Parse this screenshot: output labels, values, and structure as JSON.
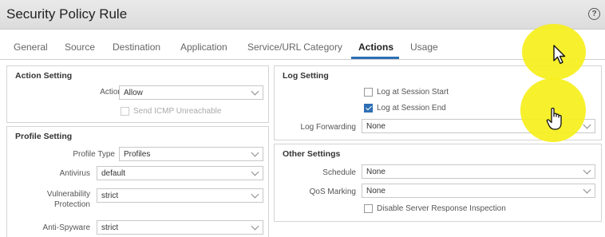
{
  "window": {
    "title": "Security Policy Rule",
    "help_icon": "?"
  },
  "tabs": [
    {
      "label": "General"
    },
    {
      "label": "Source"
    },
    {
      "label": "Destination"
    },
    {
      "label": "Application"
    },
    {
      "label": "Service/URL Category"
    },
    {
      "label": "Actions",
      "active": true
    },
    {
      "label": "Usage"
    }
  ],
  "action_setting": {
    "title": "Action Setting",
    "action_label": "Action",
    "action_value": "Allow",
    "send_icmp_label": "Send ICMP Unreachable",
    "send_icmp_checked": false
  },
  "profile_setting": {
    "title": "Profile Setting",
    "profile_type_label": "Profile Type",
    "profile_type_value": "Profiles",
    "antivirus_label": "Antivirus",
    "antivirus_value": "default",
    "vulnerability_label_1": "Vulnerability",
    "vulnerability_label_2": "Protection",
    "vulnerability_value": "strict",
    "antispyware_label": "Anti-Spyware",
    "antispyware_value": "strict"
  },
  "log_setting": {
    "title": "Log Setting",
    "log_start_label": "Log at Session Start",
    "log_start_checked": false,
    "log_end_label": "Log at Session End",
    "log_end_checked": true,
    "log_forwarding_label": "Log Forwarding",
    "log_forwarding_value": "None"
  },
  "other_settings": {
    "title": "Other Settings",
    "schedule_label": "Schedule",
    "schedule_value": "None",
    "qos_label": "QoS Marking",
    "qos_value": "None",
    "disable_inspection_label": "Disable Server Response Inspection",
    "disable_inspection_checked": false
  },
  "colors": {
    "accent": "#2d6fb3",
    "highlight": "#f6ef1a"
  }
}
